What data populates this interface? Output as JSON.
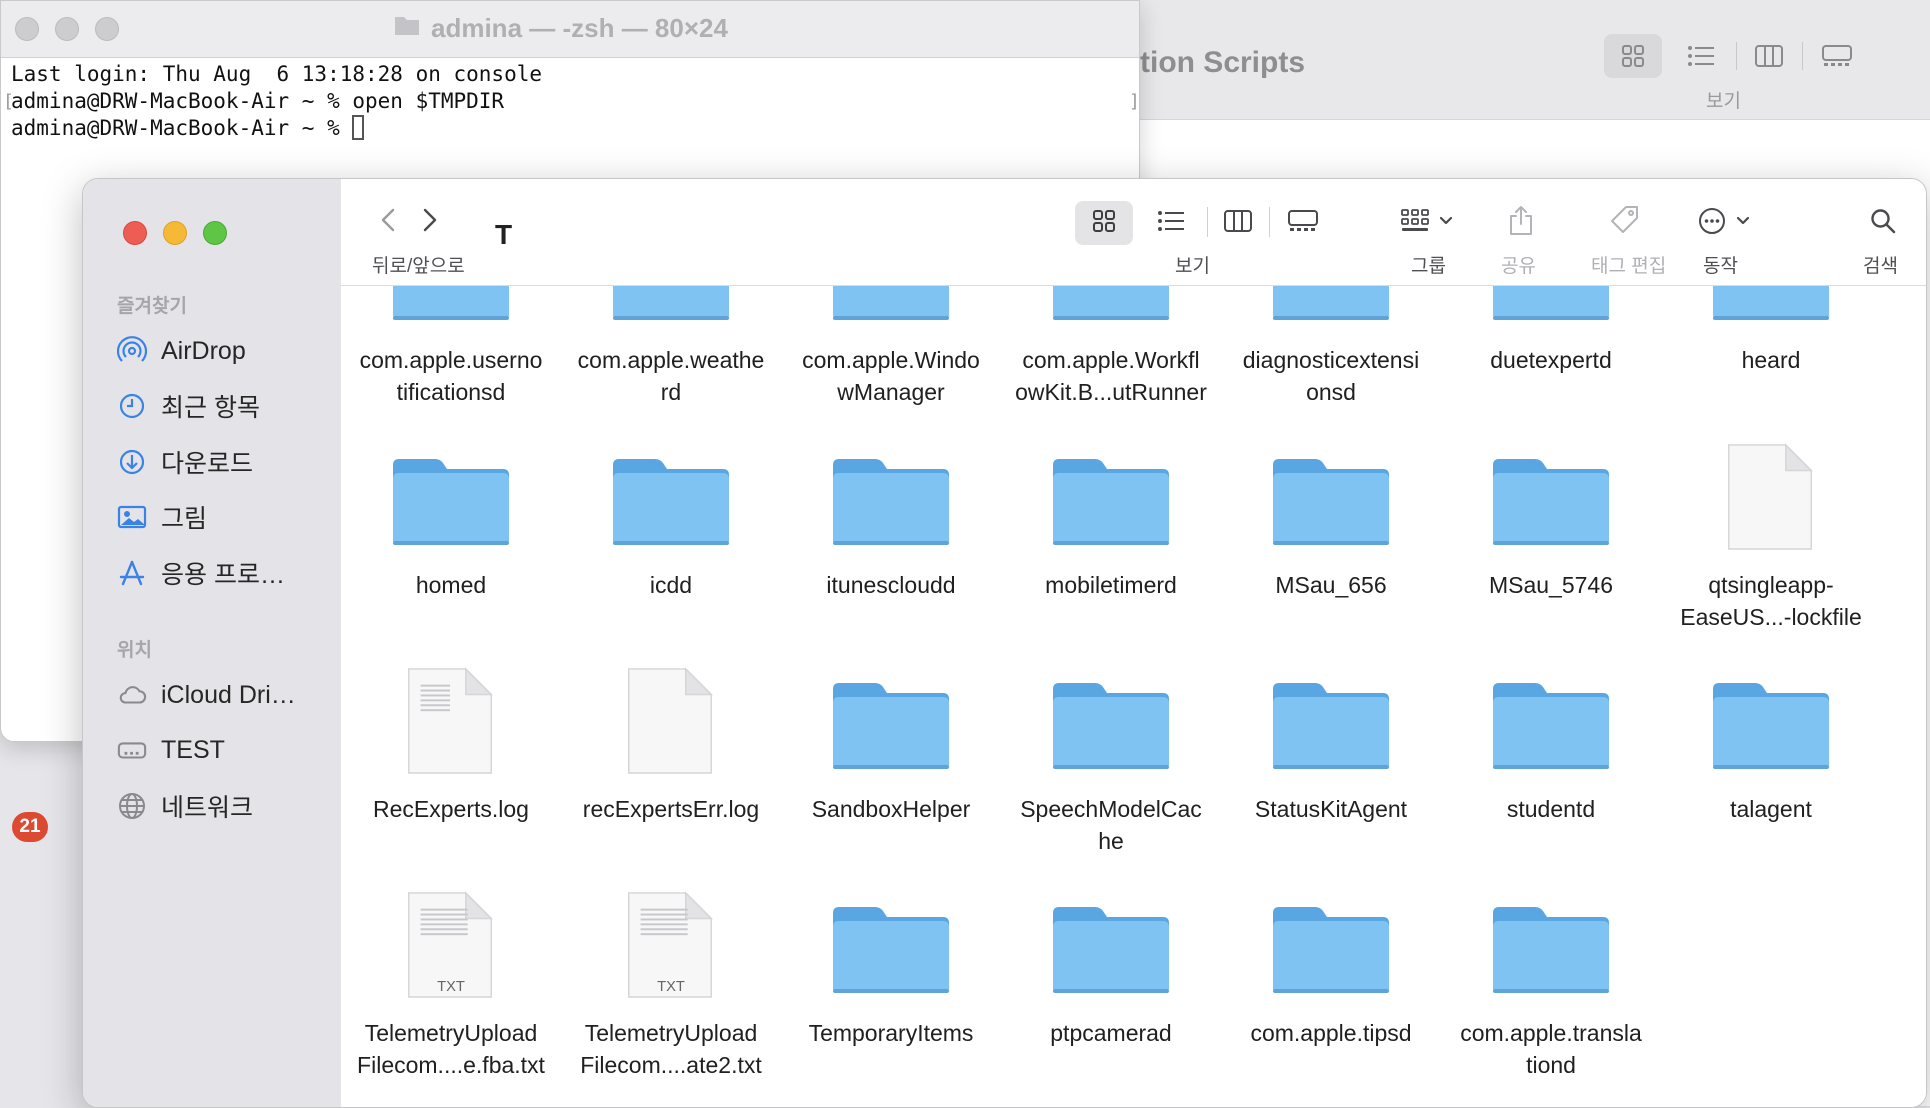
{
  "background_window": {
    "title_fragment": "tion Scripts",
    "view_label": "보기"
  },
  "terminal": {
    "title": "admina — -zsh — 80×24",
    "lines": [
      "Last login: Thu Aug  6 13:18:28 on console",
      "admina@DRW-MacBook-Air ~ % open $TMPDIR",
      "admina@DRW-MacBook-Air ~ % "
    ]
  },
  "dock_badge": "21",
  "finder": {
    "folder_title": "T",
    "toolbar": {
      "back_forward_label": "뒤로/앞으로",
      "view_label": "보기",
      "group_label": "그룹",
      "share_label": "공유",
      "tag_label": "태그 편집",
      "action_label": "동작",
      "search_label": "검색"
    },
    "sidebar": {
      "favorites_header": "즐겨찾기",
      "favorites": [
        {
          "label": "AirDrop",
          "icon": "airdrop-icon"
        },
        {
          "label": "최근 항목",
          "icon": "clock-icon"
        },
        {
          "label": "다운로드",
          "icon": "download-icon"
        },
        {
          "label": "그림",
          "icon": "picture-icon"
        },
        {
          "label": "응용 프로…",
          "icon": "applications-icon"
        }
      ],
      "locations_header": "위치",
      "locations": [
        {
          "label": "iCloud Dri…",
          "icon": "cloud-icon"
        },
        {
          "label": "TEST",
          "icon": "drive-icon"
        },
        {
          "label": "네트워크",
          "icon": "network-icon"
        }
      ]
    },
    "rows": [
      [
        {
          "name": "com.apple.userno\ntificationsd",
          "kind": "folder"
        },
        {
          "name": "com.apple.weathe\nrd",
          "kind": "folder"
        },
        {
          "name": "com.apple.Windo\nwManager",
          "kind": "folder"
        },
        {
          "name": "com.apple.Workfl\nowKit.B...utRunner",
          "kind": "folder"
        },
        {
          "name": "diagnosticextensi\nonsd",
          "kind": "folder"
        },
        {
          "name": "duetexpertd",
          "kind": "folder"
        },
        {
          "name": "heard",
          "kind": "folder"
        }
      ],
      [
        {
          "name": "homed",
          "kind": "folder"
        },
        {
          "name": "icdd",
          "kind": "folder"
        },
        {
          "name": "itunescloudd",
          "kind": "folder"
        },
        {
          "name": "mobiletimerd",
          "kind": "folder"
        },
        {
          "name": "MSau_656",
          "kind": "folder"
        },
        {
          "name": "MSau_5746",
          "kind": "folder"
        },
        {
          "name": "qtsingleapp-\nEaseUS...-lockfile",
          "kind": "file"
        }
      ],
      [
        {
          "name": "RecExperts.log",
          "kind": "log"
        },
        {
          "name": "recExpertsErr.log",
          "kind": "file"
        },
        {
          "name": "SandboxHelper",
          "kind": "folder"
        },
        {
          "name": "SpeechModelCac\nhe",
          "kind": "folder"
        },
        {
          "name": "StatusKitAgent",
          "kind": "folder"
        },
        {
          "name": "studentd",
          "kind": "folder"
        },
        {
          "name": "talagent",
          "kind": "folder"
        }
      ],
      [
        {
          "name": "TelemetryUpload\nFilecom....e.fba.txt",
          "kind": "txt",
          "badge": "TXT"
        },
        {
          "name": "TelemetryUpload\nFilecom....ate2.txt",
          "kind": "txt",
          "badge": "TXT"
        },
        {
          "name": "TemporaryItems",
          "kind": "folder"
        },
        {
          "name": "ptpcamerad",
          "kind": "folder"
        },
        {
          "name": "com.apple.tipsd",
          "kind": "folder"
        },
        {
          "name": "com.apple.transla\ntiond",
          "kind": "folder"
        }
      ]
    ],
    "colors": {
      "folder_body": "#7ec3f1",
      "folder_tab": "#5aa6e2",
      "accent": "#3b82e6"
    }
  }
}
